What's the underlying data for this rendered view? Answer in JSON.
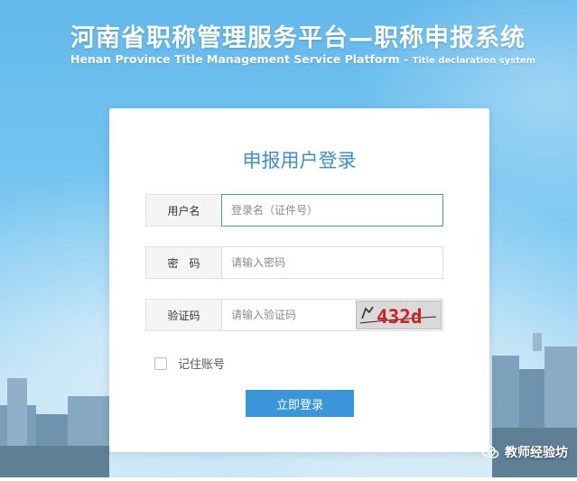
{
  "header": {
    "title_cn": "河南省职称管理服务平台—职称申报系统",
    "title_en_main": "Henan Province Title Management Service Platform -",
    "title_en_sub": "Title declaration system"
  },
  "login": {
    "title": "申报用户登录",
    "username_label": "用户名",
    "username_placeholder": "登录名（证件号）",
    "password_label": "密　码",
    "password_placeholder": "请输入密码",
    "captcha_label": "验证码",
    "captcha_placeholder": "请输入验证码",
    "captcha_text": "432d",
    "remember_label": "记住账号",
    "submit_label": "立即登录"
  },
  "watermark": {
    "text": "教师经验坊"
  },
  "colors": {
    "accent": "#3a96d8",
    "title_blue": "#3d8ed1",
    "captcha_red": "#d21f1f"
  }
}
